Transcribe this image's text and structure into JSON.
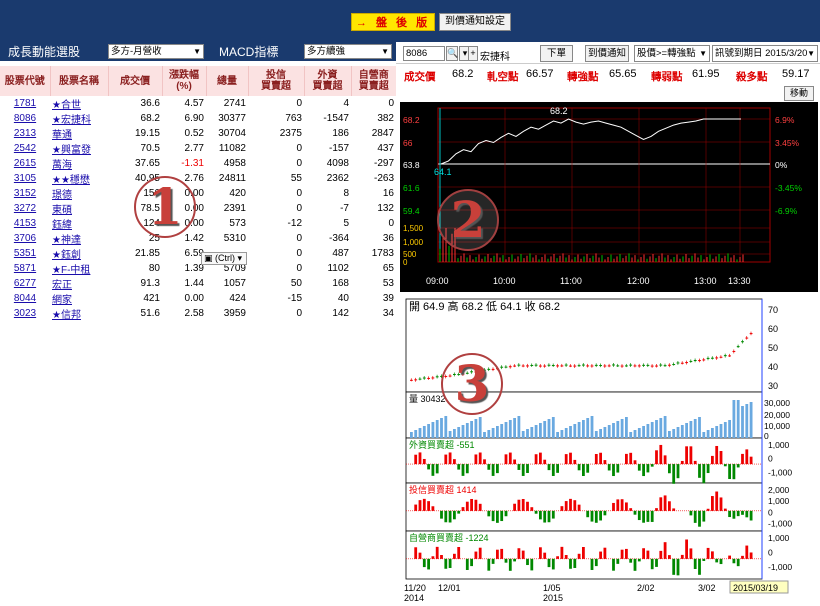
{
  "header": {
    "after_hours_label": "→ 盤 後 版",
    "price_alert_label": "到價通知設定"
  },
  "left_toolbar": {
    "growth_title": "成長動能選股",
    "growth_select": "多方-月營收",
    "macd_title": "MACD指標",
    "macd_select": "多方續強"
  },
  "table": {
    "headers": [
      "股票代號",
      "股票名稱",
      "成交價",
      "漲跌幅\n(%)",
      "總量",
      "投信\n買賣超",
      "外資\n買賣超",
      "自營商\n買賣超"
    ],
    "rows": [
      {
        "code": "1781",
        "name": "★合世",
        "price": "36.6",
        "chg": "4.57",
        "vol": "2741",
        "trust": "0",
        "foreign": "4",
        "dealer": "0"
      },
      {
        "code": "8086",
        "name": "★宏捷科",
        "price": "68.2",
        "chg": "6.90",
        "vol": "30377",
        "trust": "763",
        "foreign": "-1547",
        "dealer": "382"
      },
      {
        "code": "2313",
        "name": "華通",
        "price": "19.15",
        "chg": "0.52",
        "vol": "30704",
        "trust": "2375",
        "foreign": "186",
        "dealer": "2847"
      },
      {
        "code": "2542",
        "name": "★興富發",
        "price": "70.5",
        "chg": "2.77",
        "vol": "11082",
        "trust": "0",
        "foreign": "-157",
        "dealer": "437"
      },
      {
        "code": "2615",
        "name": "萬海",
        "price": "37.65",
        "chg": "-1.31",
        "vol": "4958",
        "trust": "0",
        "foreign": "4098",
        "dealer": "-297"
      },
      {
        "code": "3105",
        "name": "★★穩懋",
        "price": "40.95",
        "chg": "2.76",
        "vol": "24811",
        "trust": "55",
        "foreign": "2362",
        "dealer": "-263"
      },
      {
        "code": "3152",
        "name": "璟德",
        "price": "156",
        "chg": "0.00",
        "vol": "420",
        "trust": "0",
        "foreign": "8",
        "dealer": "16"
      },
      {
        "code": "3272",
        "name": "東碩",
        "price": "78.5",
        "chg": "0.00",
        "vol": "2391",
        "trust": "0",
        "foreign": "-7",
        "dealer": "132"
      },
      {
        "code": "4153",
        "name": "鈺緯",
        "price": "124",
        "chg": "0.00",
        "vol": "573",
        "trust": "-12",
        "foreign": "5",
        "dealer": "0"
      },
      {
        "code": "3706",
        "name": "★神達",
        "price": "25",
        "chg": "1.42",
        "vol": "5310",
        "trust": "0",
        "foreign": "-364",
        "dealer": "36"
      },
      {
        "code": "5351",
        "name": "★鈺創",
        "price": "21.85",
        "chg": "6.59",
        "vol": "",
        "trust": "0",
        "foreign": "487",
        "dealer": "1783"
      },
      {
        "code": "5871",
        "name": "★F-中租",
        "price": "80",
        "chg": "1.39",
        "vol": "5709",
        "trust": "0",
        "foreign": "1102",
        "dealer": "65"
      },
      {
        "code": "6277",
        "name": "宏正",
        "price": "91.3",
        "chg": "1.44",
        "vol": "1057",
        "trust": "50",
        "foreign": "168",
        "dealer": "53"
      },
      {
        "code": "8044",
        "name": "網家",
        "price": "421",
        "chg": "0.00",
        "vol": "424",
        "trust": "-15",
        "foreign": "40",
        "dealer": "39"
      },
      {
        "code": "3023",
        "name": "★信邦",
        "price": "51.6",
        "chg": "2.58",
        "vol": "3959",
        "trust": "0",
        "foreign": "142",
        "dealer": "34"
      }
    ],
    "paste_tag": "(Ctrl)"
  },
  "circles": {
    "one": "1",
    "two": "2",
    "three": "3"
  },
  "right_toolbar": {
    "code": "8086",
    "stock_name": "宏捷科",
    "order_btn": "下單",
    "alert_btn": "到價通知",
    "cond_select": "股價>=轉強點",
    "date_select": "訊號到期日 2015/3/20"
  },
  "quote": {
    "items": [
      {
        "label": "成交價",
        "value": "68.2"
      },
      {
        "label": "軋空點",
        "value": "66.57"
      },
      {
        "label": "轉強點",
        "value": "65.65"
      },
      {
        "label": "轉弱點",
        "value": "61.95"
      },
      {
        "label": "殺多點",
        "value": "59.17"
      }
    ],
    "move_btn": "移動"
  },
  "intraday": {
    "price_labels": [
      "68.2",
      "66",
      "63.8",
      "61.6",
      "59.4"
    ],
    "pct_labels": [
      "6.9%",
      "3.45%",
      "0%",
      "-3.45%",
      "-6.9%"
    ],
    "vol_labels": [
      "1,500",
      "1,000",
      "500",
      "0"
    ],
    "time_labels": [
      "09:00",
      "10:00",
      "11:00",
      "12:00",
      "13:00",
      "13:30"
    ],
    "high_mark": "68.2",
    "low_mark": "64.1",
    "colors": {
      "up": "#ff3030",
      "down": "#00c000",
      "ref": "#ffffff",
      "grid": "#a00000"
    }
  },
  "kline": {
    "ohlc_label": "開 64.9  高 68.2  低 64.1  收 68.2",
    "price_ticks": [
      "70",
      "60",
      "50",
      "40",
      "30"
    ],
    "volume_label": "量 30432",
    "volume_ticks": [
      "30,000",
      "20,000",
      "10,000",
      "0"
    ],
    "foreign_label": "外資買賣超 -551",
    "trust_label": "投信買賣超 1414",
    "dealer_label": "自營商買賣超 -1224",
    "net_ticks_a": [
      "1,000",
      "0",
      "-1,000"
    ],
    "net_ticks_b": [
      "2,000",
      "1,000",
      "0",
      "-1,000"
    ],
    "date_labels": [
      "11/20\n2014",
      "12/01",
      "1/05\n2015",
      "2/02",
      "3/02"
    ],
    "date_tag": "2015/03/19"
  }
}
